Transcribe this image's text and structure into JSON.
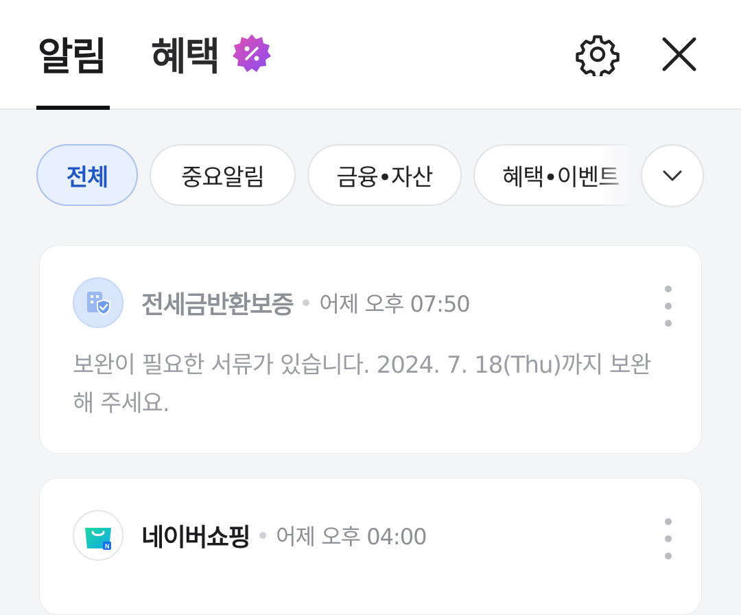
{
  "header": {
    "tab_alerts": "알림",
    "tab_benefits": "혜택"
  },
  "icons": {
    "benefit_badge": "percent-badge-icon",
    "settings": "gear-icon",
    "close": "close-icon",
    "expand": "chevron-down-icon",
    "more": "kebab-menu-icon"
  },
  "filters": {
    "items": [
      "전체",
      "중요알림",
      "금융•자산",
      "혜택•이벤트"
    ],
    "selected": "전체"
  },
  "notifications": [
    {
      "sender": "전세금반환보증",
      "time": "어제 오후 07:50",
      "message": "보완이 필요한 서류가 있습니다. 2024. 7. 18(Thu)까지 보완해 주세요.",
      "icon": "building-shield-icon"
    },
    {
      "sender": "네이버쇼핑",
      "time": "어제 오후 04:00",
      "icon": "shopping-bag-icon"
    }
  ],
  "colors": {
    "accent": "#1f56c8",
    "active_chip_bg": "#e8effd",
    "badge_start": "#e14fb3",
    "badge_end": "#8a4cf0"
  }
}
